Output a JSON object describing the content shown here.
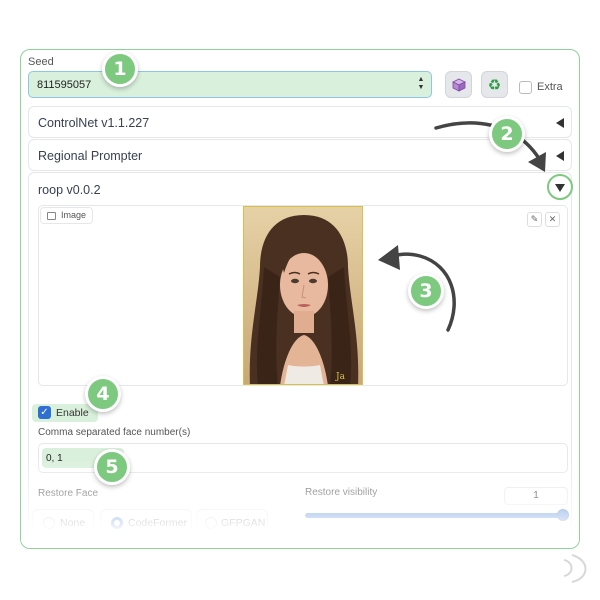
{
  "seed": {
    "label": "Seed",
    "value": "811595057",
    "extra_label": "Extra"
  },
  "accordions": {
    "controlnet": "ControlNet v1.1.227",
    "regional": "Regional Prompter",
    "roop": "roop v0.0.2"
  },
  "image": {
    "tag": "Image",
    "edit": "✎",
    "close": "✕",
    "photo_watermark": "Ja"
  },
  "enable": {
    "label": "Enable",
    "checked": true
  },
  "faces": {
    "label": "Comma separated face number(s)",
    "value": "0, 1"
  },
  "restore": {
    "label": "Restore Face",
    "options": [
      "None",
      "CodeFormer",
      "GFPGAN"
    ],
    "selected": "CodeFormer",
    "visibility_label": "Restore visibility",
    "visibility_value": "1"
  },
  "badges": [
    "1",
    "2",
    "3",
    "4",
    "5"
  ],
  "colors": {
    "accent_green": "#7dc97f",
    "highlight": "#d9f0dc",
    "primary_blue": "#2f6fd1"
  }
}
